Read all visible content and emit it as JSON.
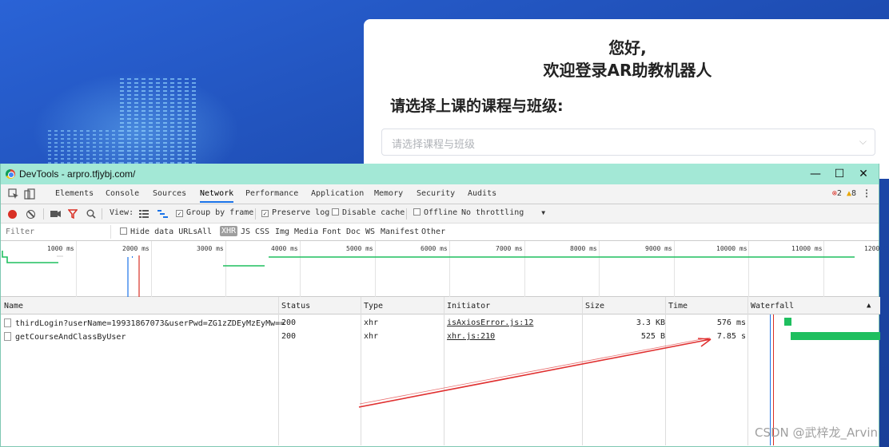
{
  "page": {
    "greeting_line1": "您好,",
    "greeting_line2": "欢迎登录AR助教机器人",
    "course_prompt": "请选择上课的课程与班级:",
    "course_select_placeholder": "请选择课程与班级"
  },
  "devtools": {
    "window_title": "DevTools - arpro.tfjybj.com/",
    "tabs": [
      {
        "label": "Elements"
      },
      {
        "label": "Console"
      },
      {
        "label": "Sources"
      },
      {
        "label": "Network"
      },
      {
        "label": "Performance"
      },
      {
        "label": "Application"
      },
      {
        "label": "Memory"
      },
      {
        "label": "Security"
      },
      {
        "label": "Audits"
      }
    ],
    "active_tab": "Network",
    "error_count": "2",
    "warning_count": "8",
    "toolbar": {
      "view_label": "View:",
      "group_by_frame": "Group by frame",
      "preserve_log": "Preserve log",
      "disable_cache": "Disable cache",
      "offline": "Offline",
      "throttling": "No throttling"
    },
    "filter": {
      "placeholder": "Filter",
      "hide_data_urls": "Hide data URLs",
      "types": [
        "All",
        "XHR",
        "JS",
        "CSS",
        "Img",
        "Media",
        "Font",
        "Doc",
        "WS",
        "Manifest",
        "Other"
      ]
    },
    "timeline_ticks": [
      "1000 ms",
      "2000 ms",
      "3000 ms",
      "4000 ms",
      "5000 ms",
      "6000 ms",
      "7000 ms",
      "8000 ms",
      "9000 ms",
      "10000 ms",
      "11000 ms",
      "1200"
    ],
    "columns": [
      "Name",
      "Status",
      "Type",
      "Initiator",
      "Size",
      "Time",
      "Waterfall"
    ],
    "rows": [
      {
        "name": "thirdLogin?userName=19931867073&userPwd=ZG1zZDEyMzEyMw==",
        "status": "200",
        "type": "xhr",
        "initiator": "isAxiosError.js:12",
        "size": "3.3 KB",
        "time": "576 ms"
      },
      {
        "name": "getCourseAndClassByUser",
        "status": "200",
        "type": "xhr",
        "initiator": "xhr.js:210",
        "size": "525 B",
        "time": "7.85 s"
      }
    ]
  },
  "watermark": "CSDN @武梓龙_Arvin",
  "colors": {
    "accent": "#1a73e8",
    "titlebar": "#a3e8d6",
    "waterfall_bar": "#1fbf5f",
    "arrow": "#e03030"
  }
}
